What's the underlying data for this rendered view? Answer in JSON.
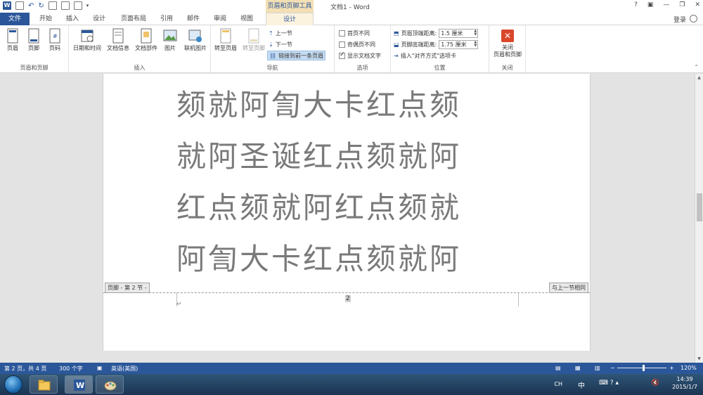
{
  "titlebar": {
    "context_tab": "页眉和页脚工具",
    "doc_title": "文档1 - Word",
    "help": "?",
    "restore_ribbon": "▣",
    "minimize": "—",
    "maximize": "❐",
    "close": "✕"
  },
  "tabs": {
    "file": "文件",
    "items": [
      "开始",
      "插入",
      "设计",
      "页面布局",
      "引用",
      "邮件",
      "审阅",
      "视图"
    ],
    "design": "设计",
    "signin": "登录"
  },
  "ribbon": {
    "header_footer_group": {
      "label": "页眉和页脚",
      "header": "页眉",
      "footer": "页脚",
      "page_number": "页码"
    },
    "insert_group": {
      "label": "插入",
      "date_time": "日期和时间",
      "doc_info": "文档信息",
      "doc_parts": "文档部件",
      "picture": "图片",
      "online_picture": "联机图片"
    },
    "navigation_group": {
      "label": "导航",
      "goto_header": "转至页眉",
      "goto_footer": "转至页脚",
      "previous": "上一节",
      "next": "下一节",
      "link_previous": "链接到前一条页眉"
    },
    "options_group": {
      "label": "选项",
      "different_first": "首页不同",
      "different_odd_even": "奇偶页不同",
      "show_doc_text": "显示文档文字"
    },
    "position_group": {
      "label": "位置",
      "header_from_top_label": "页眉顶端距离:",
      "header_from_top_value": "1.5 厘米",
      "footer_from_bottom_label": "页脚底端距离:",
      "footer_from_bottom_value": "1.75 厘米",
      "insert_align_tab": "插入\"对齐方式\"选项卡"
    },
    "close_group": {
      "label": "关闭",
      "close_line1": "关闭",
      "close_line2": "页眉和页脚"
    }
  },
  "document": {
    "lines": [
      "颏就阿訇大卡红点颏",
      "就阿圣诞红点颏就阿",
      "红点颏就阿红点颏就",
      "阿訇大卡红点颏就阿"
    ],
    "footer_tag": "页脚 - 第 2 节 -",
    "same_as_previous": "与上一节相同",
    "page_number": "2",
    "para_mark": "↵"
  },
  "statusbar": {
    "page": "第 2 页，共 4 页",
    "words": "300 个字",
    "language": "英语(美国)",
    "zoom": "120%",
    "zoom_level": 1.2
  },
  "taskbar": {
    "ime": "CH",
    "ime_mode": "中",
    "time": "14:39",
    "date": "2015/1/7"
  },
  "colors": {
    "accent": "#2b579a",
    "context_tab": "#f3dfb4",
    "close_button": "#d9472b"
  }
}
